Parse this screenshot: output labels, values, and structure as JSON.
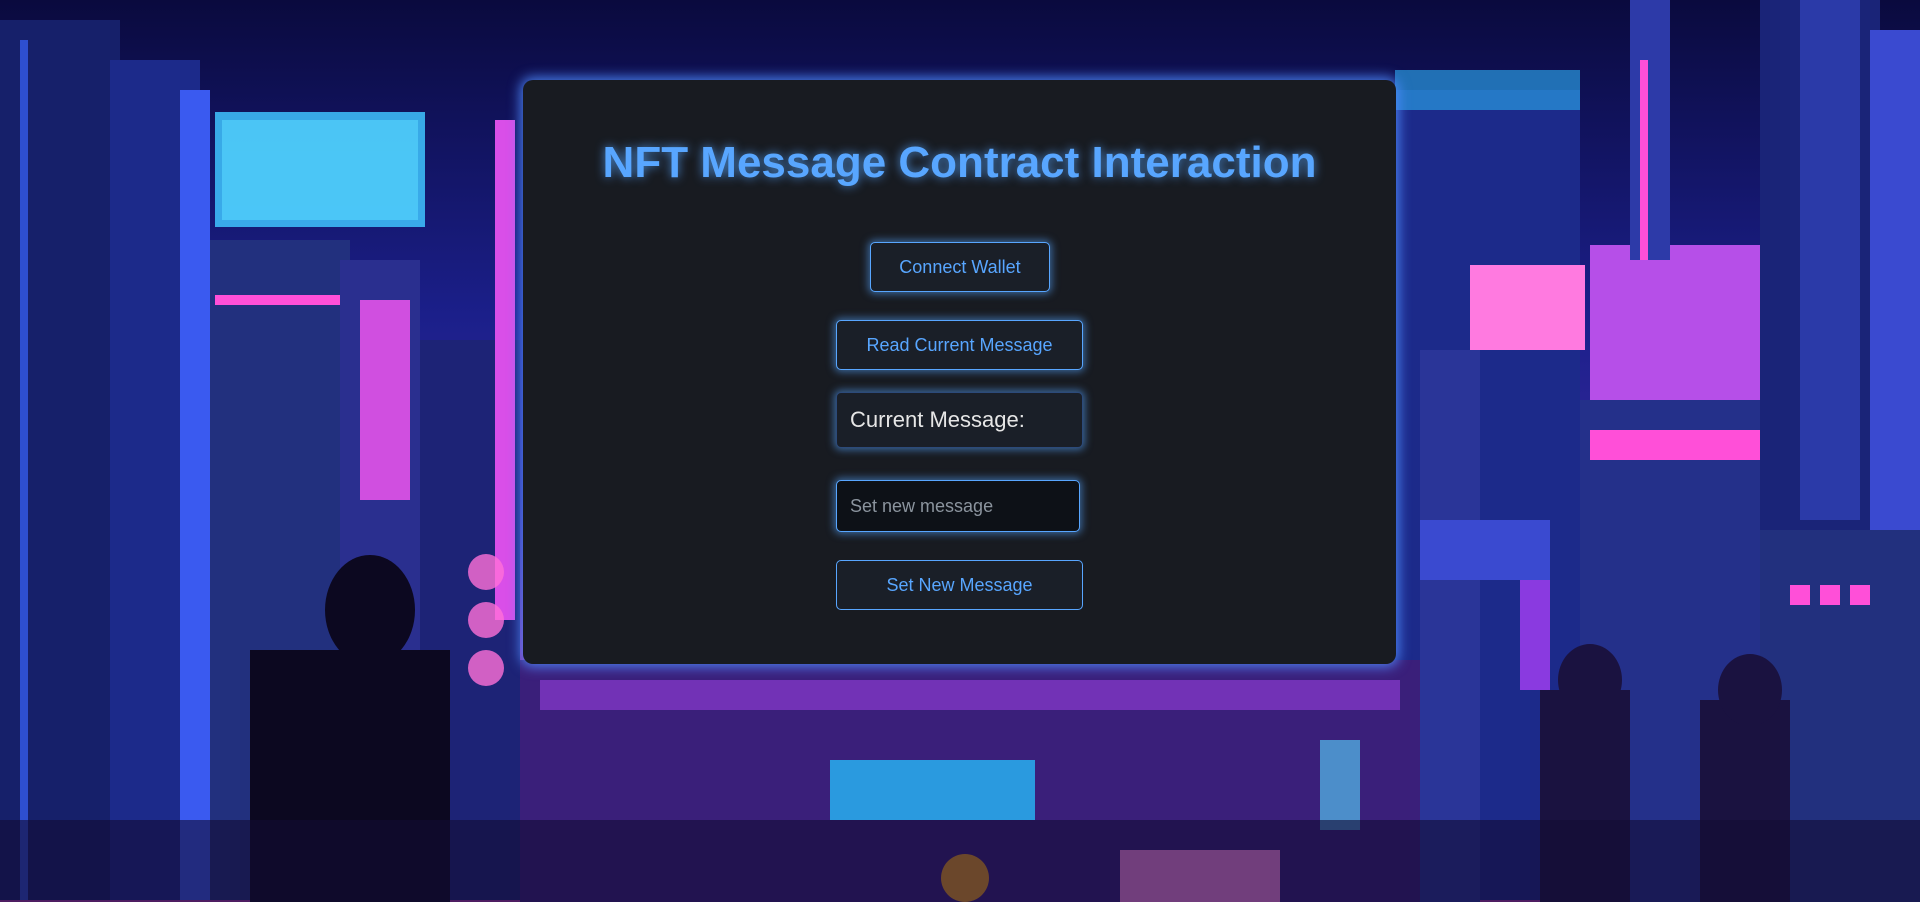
{
  "page": {
    "title": "NFT Message Contract Interaction"
  },
  "actions": {
    "connect_label": "Connect Wallet",
    "read_label": "Read Current Message",
    "set_label": "Set New Message"
  },
  "current_message": {
    "label": "Current Message:",
    "value": ""
  },
  "input": {
    "placeholder": "Set new message",
    "value": ""
  },
  "colors": {
    "accent": "#58a6ff",
    "panel": "#181b21",
    "background_theme": "pixel cyberpunk city"
  }
}
